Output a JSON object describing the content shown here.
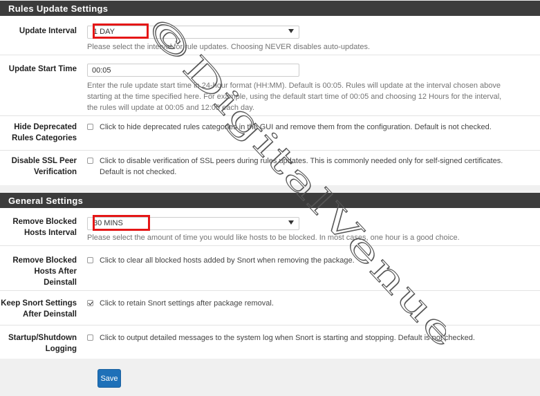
{
  "rules_update": {
    "title": "Rules Update Settings",
    "update_interval": {
      "label": "Update Interval",
      "value": "1 DAY",
      "help": "Please select the interval for rule updates. Choosing NEVER disables auto-updates."
    },
    "update_start_time": {
      "label": "Update Start Time",
      "value": "00:05",
      "help_1": "Enter the rule update start time in 24-hour format (HH:MM). Default is 00:05. Rules will update at the interval chosen above",
      "help_2": "starting at the time specified here. For example, using the default start time of 00:05 and choosing 12 Hours for the interval,",
      "help_3": "the rules will update at 00:05 and 12:05 each day."
    },
    "hide_deprecated": {
      "label_1": "Hide Deprecated",
      "label_2": "Rules Categories",
      "checked": false,
      "text": "Click to hide deprecated rules categories in the GUI and remove them from the configuration. Default is not checked."
    },
    "disable_ssl": {
      "label_1": "Disable SSL Peer",
      "label_2": "Verification",
      "checked": false,
      "text_1": "Click to disable verification of SSL peers during rules updates. This is commonly needed only for self-signed certificates.",
      "text_2": "Default is not checked."
    }
  },
  "general": {
    "title": "General Settings",
    "remove_blocked_interval": {
      "label_1": "Remove Blocked",
      "label_2": "Hosts Interval",
      "value": "30 MINS",
      "help": "Please select the amount of time you would like hosts to be blocked. In most cases, one hour is a good choice."
    },
    "remove_blocked_after": {
      "label_1": "Remove Blocked",
      "label_2": "Hosts After",
      "label_3": "Deinstall",
      "checked": false,
      "text": "Click to clear all blocked hosts added by Snort when removing the package."
    },
    "keep_snort": {
      "label_1": "Keep Snort Settings",
      "label_2": "After Deinstall",
      "checked": true,
      "text": "Click to retain Snort settings after package removal."
    },
    "startup_logging": {
      "label_1": "Startup/Shutdown",
      "label_2": "Logging",
      "checked": false,
      "text": "Click to output detailed messages to the system log when Snort is starting and stopping. Default is not checked."
    }
  },
  "save_label": "Save",
  "watermark": "©DigitalVenue",
  "colors": {
    "header_bg": "#3c3c3c",
    "highlight": "#e51616",
    "save_button": "#1e70b8"
  }
}
